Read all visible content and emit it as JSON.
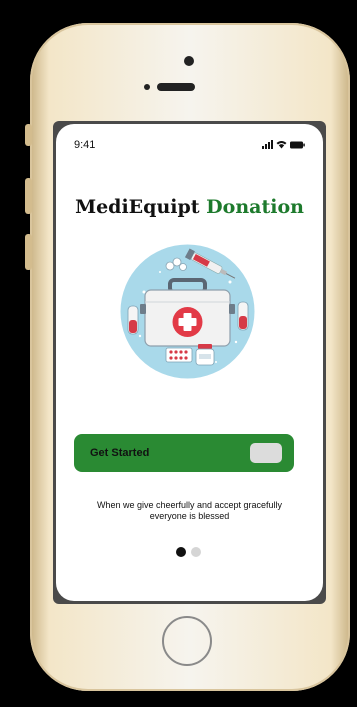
{
  "status_bar": {
    "time": "9:41"
  },
  "app": {
    "title_part1": "MediEquipt",
    "title_part2": "Donation"
  },
  "illustration": {
    "name": "medical-kit-illustration"
  },
  "cta": {
    "label": "Get Started"
  },
  "tagline": {
    "line1": "When we give cheerfully and accept gracefully",
    "line2": "everyone is blessed"
  },
  "pagination": {
    "total": 2,
    "active_index": 0
  },
  "colors": {
    "accent": "#2a8a33",
    "title_green": "#1d7a2c"
  }
}
